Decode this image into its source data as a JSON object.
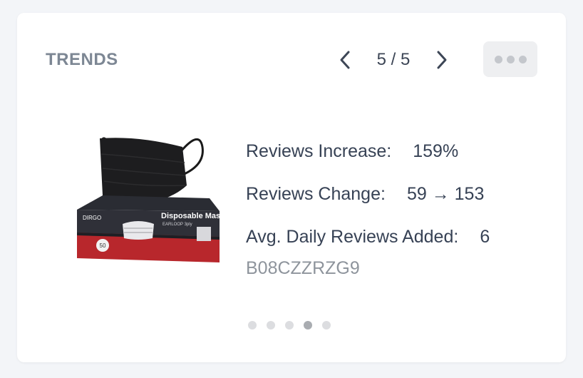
{
  "widget": {
    "title": "TRENDS",
    "pager": {
      "current": 5,
      "total": 5,
      "text": "5 / 5"
    },
    "more_icon": "more-horizontal-icon"
  },
  "product": {
    "image_icon": "disposable-mask-product-image",
    "box_brand": "DIRGO",
    "box_title": "Disposable Mask",
    "box_subtitle": "EARLOOP 3ply",
    "box_count": "50",
    "stats": [
      {
        "label": "Reviews Increase:",
        "value": "159%"
      },
      {
        "label": "Reviews Change:",
        "value": "59 → 153"
      },
      {
        "label": "Avg. Daily Reviews Added:",
        "value": "6"
      }
    ],
    "asin": "B08CZZRZG9"
  },
  "pagination": {
    "count": 5,
    "active_index": 3
  },
  "colors": {
    "card_bg": "#ffffff",
    "page_bg": "#f3f5f8",
    "title": "#7d8794",
    "text": "#374255",
    "muted": "#8e949c",
    "dot_inactive": "#dcdde0",
    "dot_active": "#a9acb1",
    "box_red": "#c62a2f"
  }
}
